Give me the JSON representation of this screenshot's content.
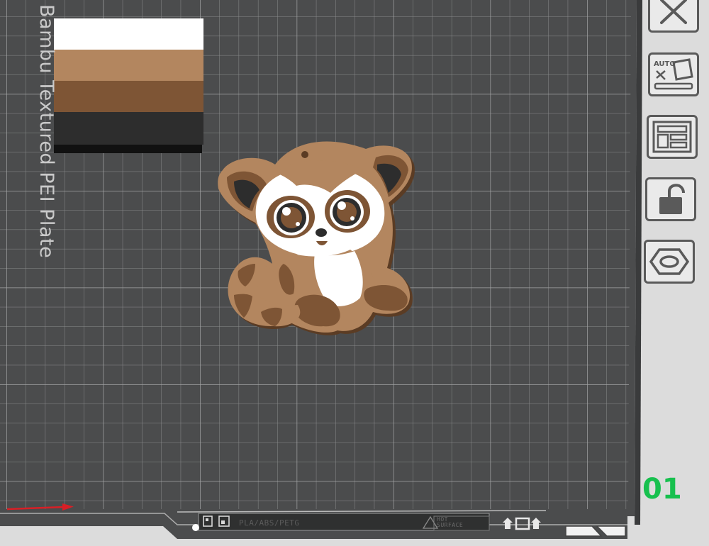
{
  "plate": {
    "name": "Bambu Textured PEI Plate",
    "number": "01",
    "filament_label": "PLA/ABS/PETG",
    "hot_surface_line1": "HOT",
    "hot_surface_line2": "SURFACE",
    "background_color": "#4b4c4d",
    "grid_color": "#8a8b8c",
    "number_color": "#17c04e"
  },
  "model": {
    "name": "cute cartoon lemur",
    "colors": [
      "#ffffff",
      "#b3865f",
      "#7e5535",
      "#2d2d2d"
    ]
  },
  "color_swatch": {
    "colors": [
      "#ffffff",
      "#b3865f",
      "#7e5535",
      "#2d2d2d",
      "#111111"
    ]
  },
  "toolbar": {
    "buttons": [
      {
        "name": "close",
        "icon": "close-icon"
      },
      {
        "name": "auto-orient",
        "icon": "auto-orient-icon",
        "label": "AUTO"
      },
      {
        "name": "arrange",
        "icon": "arrange-icon"
      },
      {
        "name": "lock",
        "icon": "unlock-icon"
      },
      {
        "name": "plate-settings",
        "icon": "hex-nut-icon"
      }
    ]
  }
}
